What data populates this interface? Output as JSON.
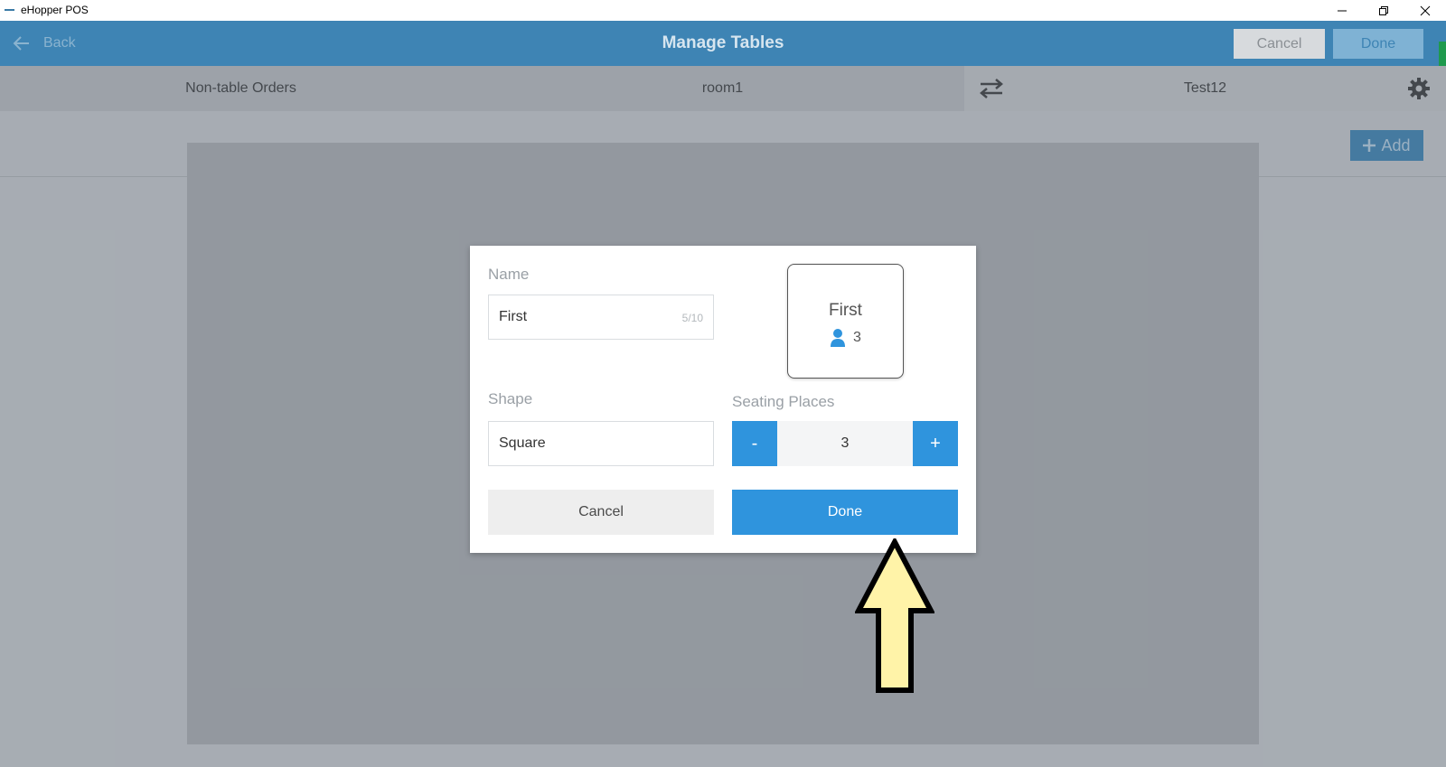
{
  "window": {
    "app_title": "eHopper POS"
  },
  "header": {
    "back_label": "Back",
    "title": "Manage Tables",
    "cancel_label": "Cancel",
    "done_label": "Done"
  },
  "tabs": [
    {
      "label": "Non-table Orders"
    },
    {
      "label": "room1"
    },
    {
      "label": "Test12"
    }
  ],
  "canvas": {
    "add_label": "Add"
  },
  "dialog": {
    "name_label": "Name",
    "name_value": "First",
    "name_counter": "5/10",
    "shape_label": "Shape",
    "shape_value": "Square",
    "seating_label": "Seating Places",
    "seating_minus": "-",
    "seating_value": "3",
    "seating_plus": "+",
    "preview_name": "First",
    "preview_seats": "3",
    "cancel_label": "Cancel",
    "done_label": "Done"
  },
  "colors": {
    "header_bg": "#3e84b4",
    "accent": "#2f94dd",
    "annotation_arrow_fill": "#fff3a8"
  },
  "icons": [
    "back-arrow-icon",
    "swap-arrows-icon",
    "gear-icon",
    "plus-icon",
    "person-icon",
    "minimize-icon",
    "restore-icon",
    "close-icon"
  ]
}
